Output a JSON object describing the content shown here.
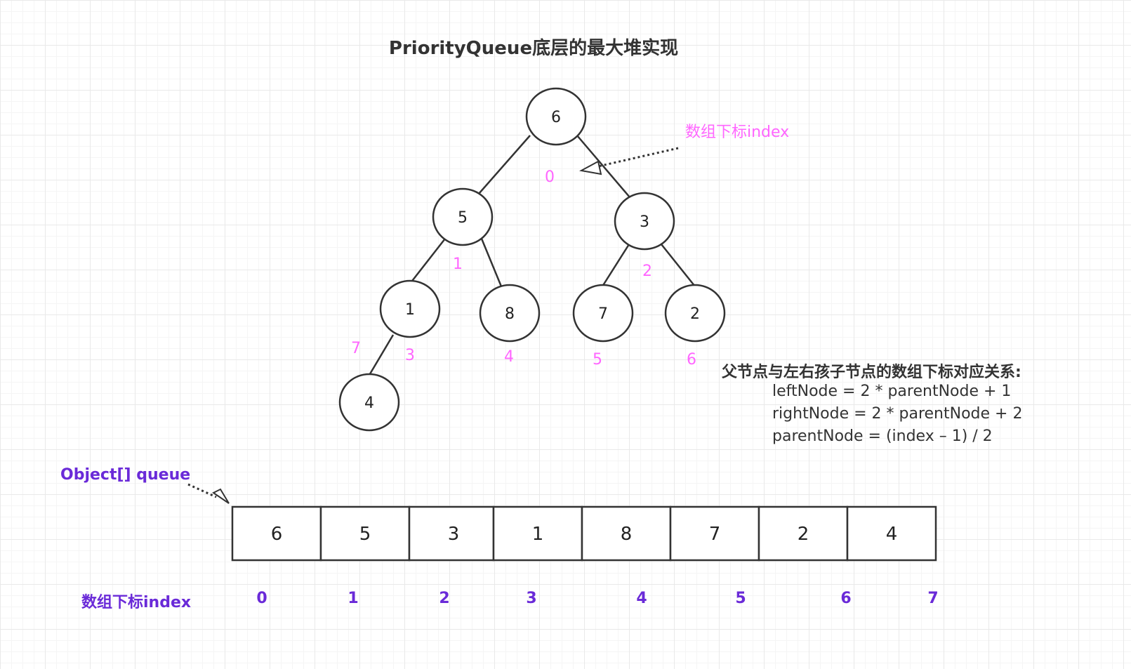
{
  "title": "PriorityQueue底层的最大堆实现",
  "heap_index_label": "数组下标index",
  "tree_nodes": [
    {
      "value": "6",
      "index": "0"
    },
    {
      "value": "5",
      "index": "1"
    },
    {
      "value": "3",
      "index": "2"
    },
    {
      "value": "1",
      "index": "3"
    },
    {
      "value": "8",
      "index": "4"
    },
    {
      "value": "7",
      "index": "5"
    },
    {
      "value": "2",
      "index": "6"
    },
    {
      "value": "4",
      "index": "7"
    }
  ],
  "relation": {
    "title": "父节点与左右孩子节点的数组下标对应关系:",
    "lines": [
      "leftNode = 2 * parentNode + 1",
      "rightNode = 2 * parentNode + 2",
      "parentNode = (index – 1) / 2"
    ]
  },
  "queue_label": "Object[] queue",
  "array_values": [
    "6",
    "5",
    "3",
    "1",
    "8",
    "7",
    "2",
    "4"
  ],
  "array_index_label": "数组下标index",
  "array_indices": [
    "0",
    "1",
    "2",
    "3",
    "4",
    "5",
    "6",
    "7"
  ],
  "colors": {
    "index_pink": "#ff66ff",
    "array_purple": "#6a2ad8",
    "text": "#333333"
  }
}
